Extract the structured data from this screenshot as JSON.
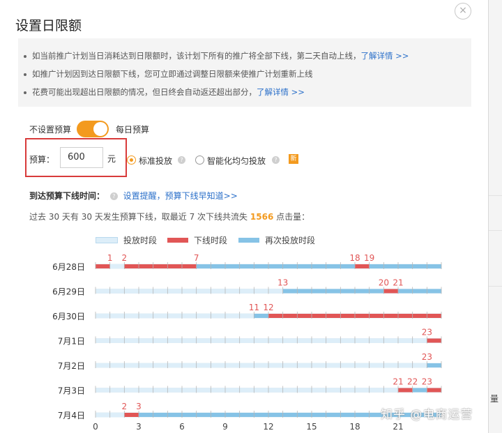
{
  "dialog": {
    "title": "设置日限额",
    "close_symbol": "×"
  },
  "notice": {
    "items": [
      {
        "text": "如当前推广计划当日消耗达到日限额时，该计划下所有的推广将全部下线，第二天自动上线，",
        "link": "了解详情 >>"
      },
      {
        "text": "如推广计划因到达日限额下线，您可立即通过调整日限额来使推广计划重新上线",
        "link": ""
      },
      {
        "text": "花费可能出现超出日限额的情况，但日终会自动返还超出部分，",
        "link": "了解详情 >>"
      }
    ]
  },
  "budget": {
    "no_budget_label": "不设置预算",
    "daily_budget_label": "每日预算",
    "toggle_on": true,
    "budget_label": "预算：",
    "budget_value": "600",
    "unit": "元",
    "delivery_options": [
      {
        "label": "标准投放",
        "selected": true
      },
      {
        "label": "智能化均匀投放",
        "selected": false
      }
    ],
    "new_badge": "新"
  },
  "offline": {
    "label": "到达预算下线时间：",
    "link": "设置提醒，预算下线早知道>>"
  },
  "summary": {
    "prefix": "过去 30 天有 30 天发生预算下线，取最近 7 次下线共流失 ",
    "count": "1566",
    "suffix": " 点击量："
  },
  "chart_data": {
    "type": "timeline",
    "legend": [
      {
        "name": "投放时段",
        "color": "#ddeef9"
      },
      {
        "name": "下线时段",
        "color": "#e15656"
      },
      {
        "name": "再次投放时段",
        "color": "#86c3e6"
      }
    ],
    "x_ticks": [
      "0",
      "3",
      "6",
      "9",
      "12",
      "15",
      "18",
      "21"
    ],
    "xlim": [
      0,
      24
    ],
    "rows": [
      {
        "date": "6月28日",
        "segments": [
          [
            "offline",
            0,
            1
          ],
          [
            "on",
            1,
            2
          ],
          [
            "offline",
            2,
            7
          ],
          [
            "again",
            7,
            18
          ],
          [
            "offline",
            18,
            19
          ],
          [
            "again",
            19,
            24
          ]
        ],
        "markers": [
          "1",
          "2",
          "7",
          "18",
          "19"
        ],
        "marker_hours": [
          1,
          2,
          7,
          18,
          19
        ]
      },
      {
        "date": "6月29日",
        "segments": [
          [
            "on",
            0,
            13
          ],
          [
            "again",
            13,
            20
          ],
          [
            "offline",
            20,
            21
          ],
          [
            "again",
            21,
            24
          ]
        ],
        "markers": [
          "13",
          "20",
          "21"
        ],
        "marker_hours": [
          13,
          20,
          21
        ]
      },
      {
        "date": "6月30日",
        "segments": [
          [
            "on",
            0,
            11
          ],
          [
            "again",
            11,
            12
          ],
          [
            "offline",
            12,
            24
          ]
        ],
        "markers": [
          "11",
          "12"
        ],
        "marker_hours": [
          11,
          12
        ]
      },
      {
        "date": "7月1日",
        "segments": [
          [
            "on",
            0,
            23
          ],
          [
            "offline",
            23,
            24
          ]
        ],
        "markers": [
          "23"
        ],
        "marker_hours": [
          23
        ]
      },
      {
        "date": "7月2日",
        "segments": [
          [
            "on",
            0,
            23
          ],
          [
            "again",
            23,
            24
          ]
        ],
        "markers": [
          "23"
        ],
        "marker_hours": [
          23
        ]
      },
      {
        "date": "7月3日",
        "segments": [
          [
            "on",
            0,
            21
          ],
          [
            "offline",
            21,
            22
          ],
          [
            "again",
            22,
            23
          ],
          [
            "offline",
            23,
            24
          ]
        ],
        "markers": [
          "21",
          "22",
          "23"
        ],
        "marker_hours": [
          21,
          22,
          23
        ]
      },
      {
        "date": "7月4日",
        "segments": [
          [
            "on",
            0,
            2
          ],
          [
            "offline",
            2,
            3
          ],
          [
            "again",
            3,
            24
          ]
        ],
        "markers": [
          "2",
          "3"
        ],
        "marker_hours": [
          2,
          3
        ]
      }
    ]
  },
  "side_fragment": "量",
  "watermark": "知乎 @电商运营"
}
